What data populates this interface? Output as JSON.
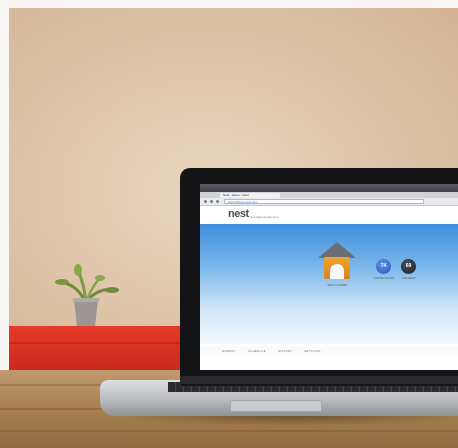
{
  "scene": {
    "description_free": true
  },
  "browser": {
    "tab_label": "Nest - Home - Nest",
    "url": "https://home.nest.com"
  },
  "site": {
    "logo": "nest",
    "account": "home@example.com",
    "home_label": "SMITH HOME",
    "circle_blue_glyph": "74",
    "circle_blue_label": "LIVING ROOM",
    "circle_dark_glyph": "69",
    "circle_dark_label": "HALLWAY",
    "footer": [
      "ENERGY",
      "SCHEDULE",
      "HISTORY",
      "SETTINGS"
    ]
  },
  "colors": {
    "accent_blue": "#3f8edc",
    "house_orange": "#f0a52d",
    "cabinet_red": "#e63a2a"
  },
  "icons": [
    "house-icon",
    "thermostat-blue-icon",
    "thermostat-dark-icon"
  ]
}
